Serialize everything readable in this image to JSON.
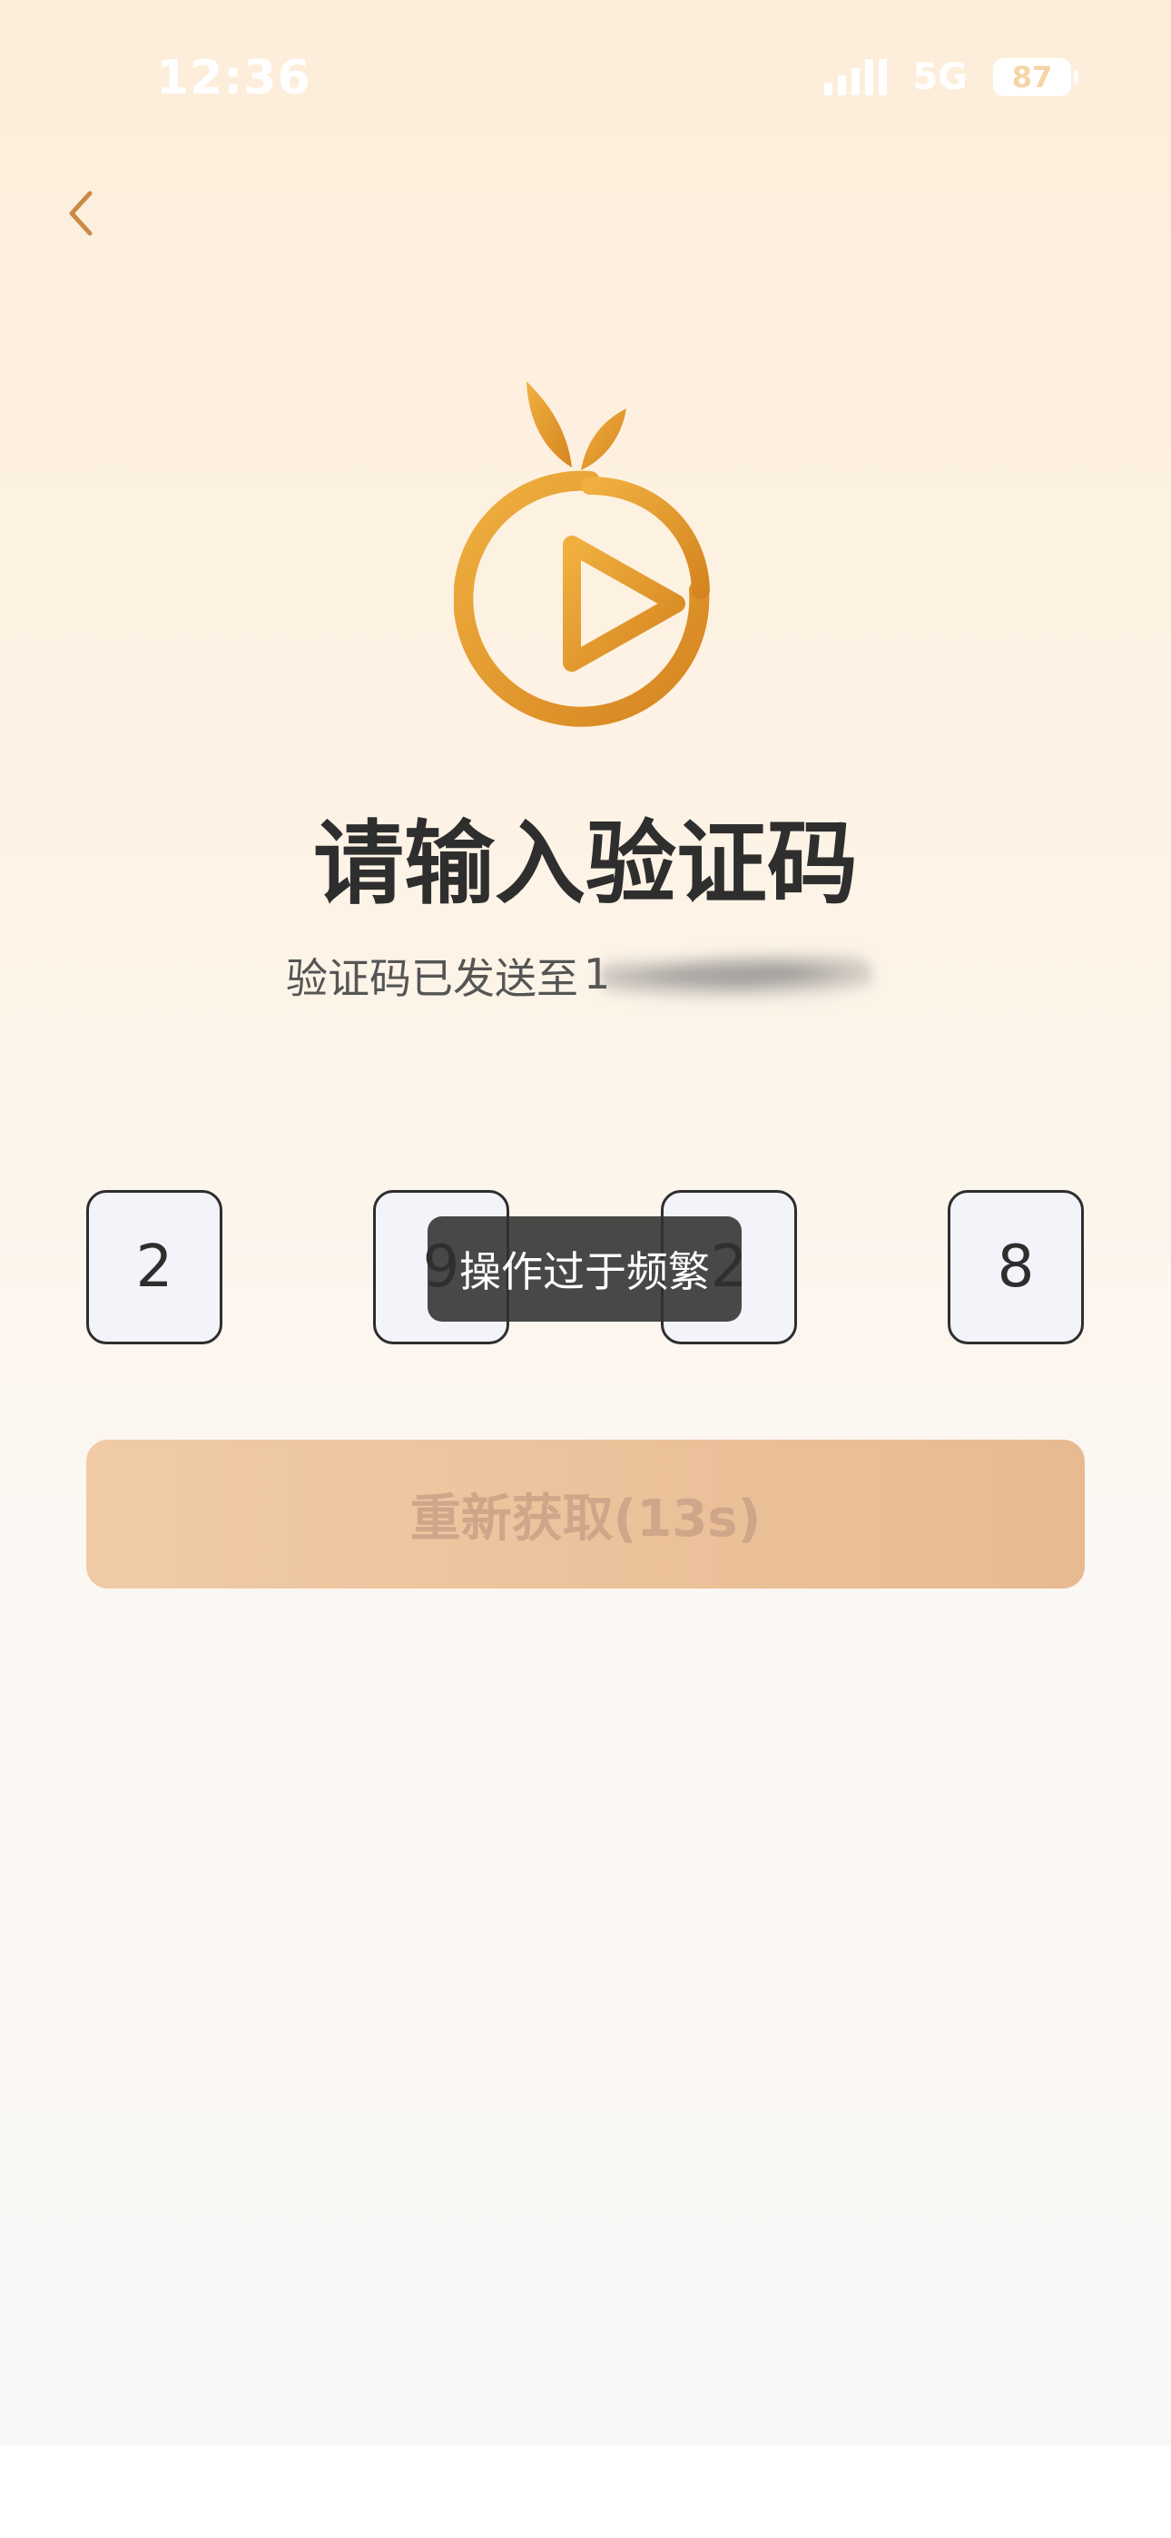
{
  "status_bar": {
    "time": "12:36",
    "network": "5G",
    "battery": "87"
  },
  "header": {
    "back_icon": "chevron-left-icon"
  },
  "logo": {
    "name": "orange-play-logo",
    "color": "#E39A2A"
  },
  "title": "请输入验证码",
  "subtitle": {
    "text": "验证码已发送至",
    "phone_visible_prefix": "1"
  },
  "code": {
    "digits": [
      "2",
      "9",
      "2",
      "8"
    ]
  },
  "toast": "操作过于频繁",
  "resend_button": {
    "label": "重新获取(13s)"
  },
  "colors": {
    "accent": "#E39A2A",
    "button": "#ECC199",
    "title": "#2E2E2E"
  }
}
